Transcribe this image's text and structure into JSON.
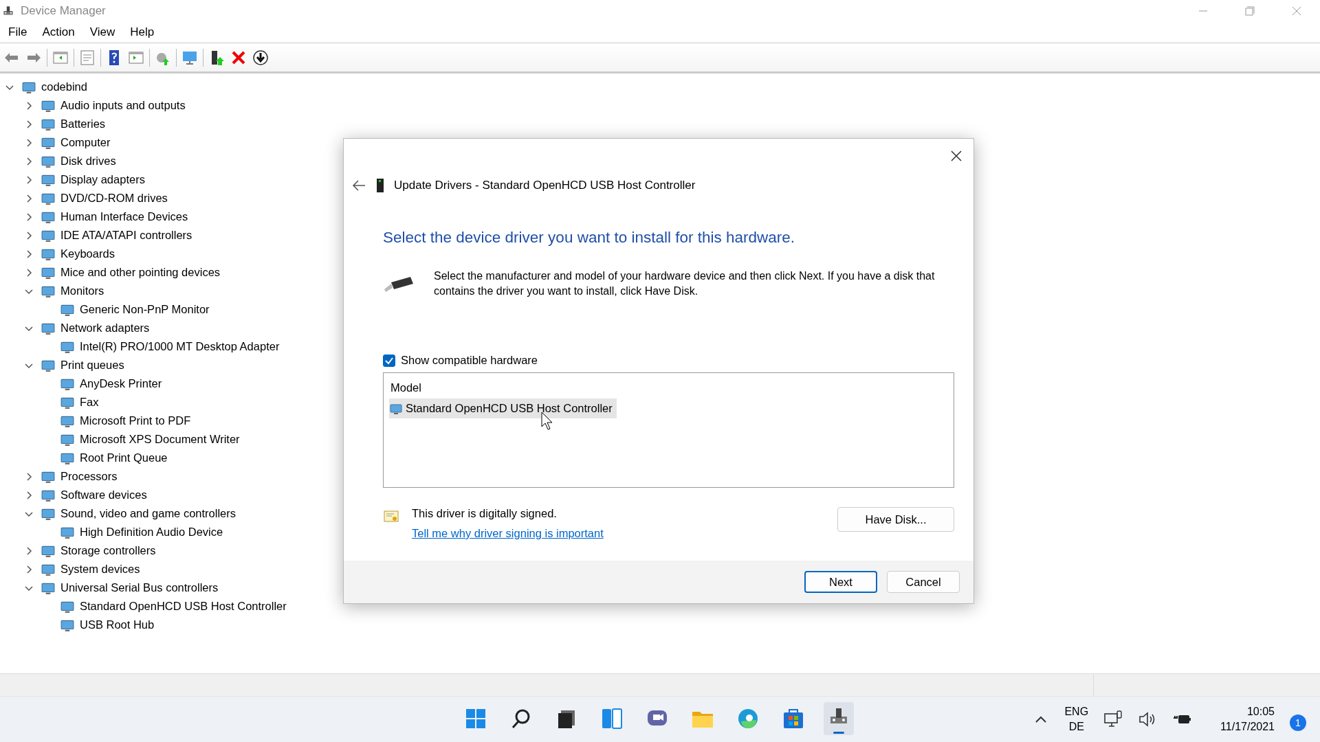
{
  "window": {
    "title": "Device Manager"
  },
  "menu": [
    "File",
    "Action",
    "View",
    "Help"
  ],
  "tree": {
    "label": "codebind",
    "expanded": true,
    "children": [
      {
        "label": "Audio inputs and outputs",
        "expanded": false
      },
      {
        "label": "Batteries",
        "expanded": false
      },
      {
        "label": "Computer",
        "expanded": false
      },
      {
        "label": "Disk drives",
        "expanded": false
      },
      {
        "label": "Display adapters",
        "expanded": false
      },
      {
        "label": "DVD/CD-ROM drives",
        "expanded": false
      },
      {
        "label": "Human Interface Devices",
        "expanded": false
      },
      {
        "label": "IDE ATA/ATAPI controllers",
        "expanded": false
      },
      {
        "label": "Keyboards",
        "expanded": false
      },
      {
        "label": "Mice and other pointing devices",
        "expanded": false
      },
      {
        "label": "Monitors",
        "expanded": true,
        "children": [
          {
            "label": "Generic Non-PnP Monitor"
          }
        ]
      },
      {
        "label": "Network adapters",
        "expanded": true,
        "children": [
          {
            "label": "Intel(R) PRO/1000 MT Desktop Adapter"
          }
        ]
      },
      {
        "label": "Print queues",
        "expanded": true,
        "children": [
          {
            "label": "AnyDesk Printer"
          },
          {
            "label": "Fax"
          },
          {
            "label": "Microsoft Print to PDF"
          },
          {
            "label": "Microsoft XPS Document Writer"
          },
          {
            "label": "Root Print Queue"
          }
        ]
      },
      {
        "label": "Processors",
        "expanded": false
      },
      {
        "label": "Software devices",
        "expanded": false
      },
      {
        "label": "Sound, video and game controllers",
        "expanded": true,
        "children": [
          {
            "label": "High Definition Audio Device"
          }
        ]
      },
      {
        "label": "Storage controllers",
        "expanded": false
      },
      {
        "label": "System devices",
        "expanded": false
      },
      {
        "label": "Universal Serial Bus controllers",
        "expanded": true,
        "children": [
          {
            "label": "Standard OpenHCD USB Host Controller"
          },
          {
            "label": "USB Root Hub"
          }
        ]
      }
    ]
  },
  "dialog": {
    "title": "Update Drivers - Standard OpenHCD USB Host Controller",
    "heading": "Select the device driver you want to install for this hardware.",
    "description": "Select the manufacturer and model of your hardware device and then click Next. If you have a disk that contains the driver you want to install, click Have Disk.",
    "show_compatible": {
      "label": "Show compatible hardware",
      "checked": true
    },
    "model_list": {
      "header": "Model",
      "items": [
        {
          "label": "Standard OpenHCD USB Host Controller",
          "selected": true
        }
      ]
    },
    "signed_text": "This driver is digitally signed.",
    "link": "Tell me why driver signing is important",
    "have_disk": "Have Disk...",
    "buttons": [
      {
        "label": "Next",
        "kind": "default"
      },
      {
        "label": "Cancel",
        "kind": "normal"
      }
    ]
  },
  "taskbar": {
    "apps": [
      {
        "kind": "start",
        "active": false
      },
      {
        "kind": "search",
        "active": false
      },
      {
        "kind": "taskview",
        "active": false
      },
      {
        "kind": "widgets",
        "active": false
      },
      {
        "kind": "chat",
        "active": false
      },
      {
        "kind": "explorer",
        "active": false
      },
      {
        "kind": "edge",
        "active": false
      },
      {
        "kind": "store",
        "active": false
      },
      {
        "kind": "devmgr",
        "active": true
      }
    ],
    "language": [
      "ENG",
      "DE"
    ],
    "time": "10:05",
    "date": "11/17/2021",
    "notifications": "1"
  }
}
